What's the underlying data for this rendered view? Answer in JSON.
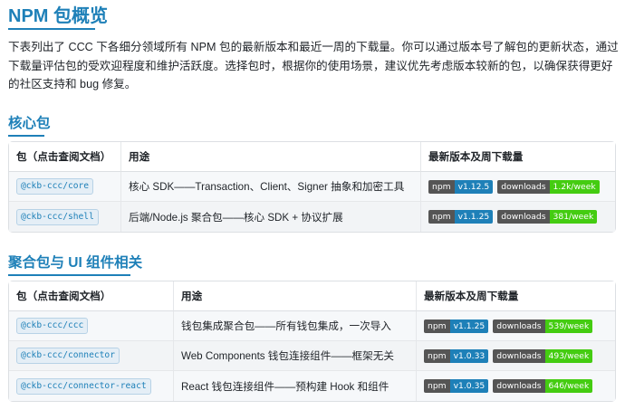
{
  "page": {
    "title": "NPM 包概览",
    "intro": "下表列出了 CCC 下各细分领域所有 NPM 包的最新版本和最近一周的下载量。你可以通过版本号了解包的更新状态，通过下载量评估包的受欢迎程度和维护活跃度。选择包时，根据你的使用场景，建议优先考虑版本较新的包，以确保获得更好的社区支持和 bug 修复。"
  },
  "colors": {
    "accent": "#1e80b8",
    "npm_badge": "#1e80b8",
    "downloads_badge": "#4c1"
  },
  "sections": [
    {
      "heading": "核心包",
      "columns": [
        "包（点击查阅文档）",
        "用途",
        "最新版本及周下载量"
      ],
      "rows": [
        {
          "package": "@ckb-ccc/core",
          "purpose": "核心 SDK——Transaction、Client、Signer 抽象和加密工具",
          "npm_label": "npm",
          "version": "v1.12.5",
          "dl_label": "downloads",
          "downloads": "1.2k/week"
        },
        {
          "package": "@ckb-ccc/shell",
          "purpose": "后端/Node.js 聚合包——核心 SDK + 协议扩展",
          "npm_label": "npm",
          "version": "v1.1.25",
          "dl_label": "downloads",
          "downloads": "381/week"
        }
      ]
    },
    {
      "heading": "聚合包与 UI 组件相关",
      "columns": [
        "包（点击查阅文档）",
        "用途",
        "最新版本及周下载量"
      ],
      "rows": [
        {
          "package": "@ckb-ccc/ccc",
          "purpose": "钱包集成聚合包——所有钱包集成，一次导入",
          "npm_label": "npm",
          "version": "v1.1.25",
          "dl_label": "downloads",
          "downloads": "539/week"
        },
        {
          "package": "@ckb-ccc/connector",
          "purpose": "Web Components 钱包连接组件——框架无关",
          "npm_label": "npm",
          "version": "v1.0.33",
          "dl_label": "downloads",
          "downloads": "493/week"
        },
        {
          "package": "@ckb-ccc/connector-react",
          "purpose": "React 钱包连接组件——预构建 Hook 和组件",
          "npm_label": "npm",
          "version": "v1.0.35",
          "dl_label": "downloads",
          "downloads": "646/week"
        }
      ]
    }
  ]
}
